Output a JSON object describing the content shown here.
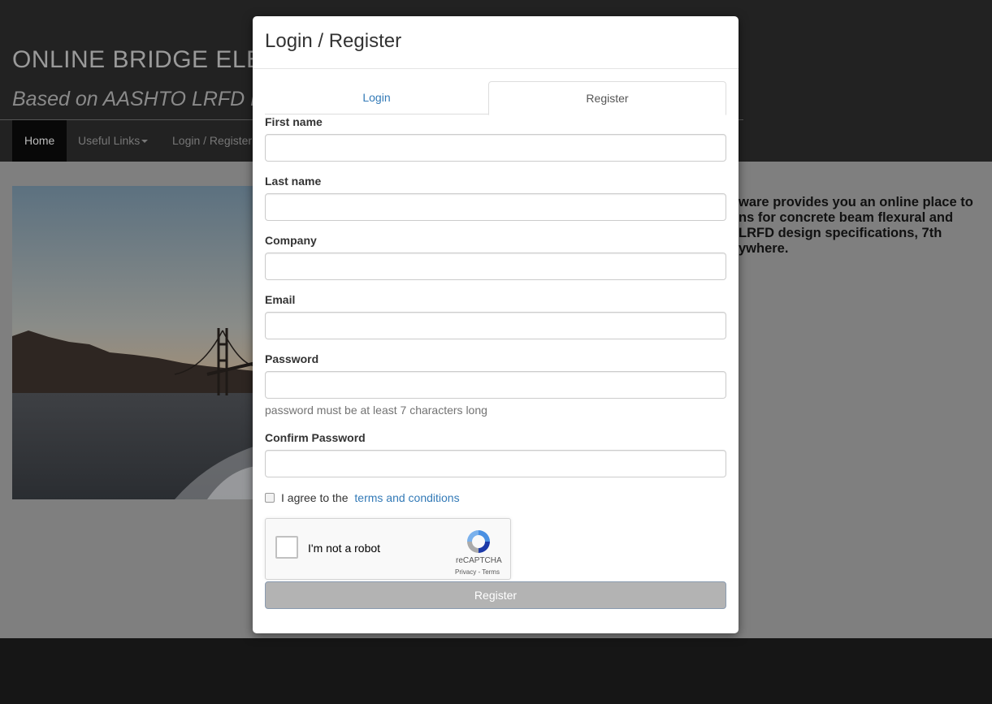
{
  "site": {
    "title": "ONLINE BRIDGE ELE",
    "subtitle": "Based on AASHTO LRFD D"
  },
  "nav": {
    "items": [
      {
        "label": "Home",
        "active": true
      },
      {
        "label": "Useful Links",
        "dropdown": true
      },
      {
        "label": "Login / Register"
      }
    ]
  },
  "intro": {
    "lines": [
      "ware provides you an online place to",
      "ns for concrete beam flexural and",
      "LRFD design specifications, 7th",
      "ywhere."
    ]
  },
  "modal": {
    "title": "Login / Register",
    "tabs": [
      {
        "label": "Login",
        "active": false
      },
      {
        "label": "Register",
        "active": true
      }
    ],
    "fields": [
      {
        "label": "First name",
        "value": ""
      },
      {
        "label": "Last name",
        "value": ""
      },
      {
        "label": "Company",
        "value": ""
      },
      {
        "label": "Email",
        "value": ""
      },
      {
        "label": "Password",
        "value": ""
      },
      {
        "label": "Confirm Password",
        "value": ""
      }
    ],
    "password_help": "password must be at least 7 characters long",
    "agree_text": "I agree to the",
    "terms_link": "terms and conditions",
    "recaptcha": {
      "label": "I'm not a robot",
      "brand": "reCAPTCHA",
      "links": "Privacy - Terms"
    },
    "submit_label": "Register"
  },
  "colors": {
    "link": "#337ab7",
    "navbar": "#222222",
    "overlay_bg": "#7f7f7f",
    "button_disabled": "#b3b3b3"
  }
}
